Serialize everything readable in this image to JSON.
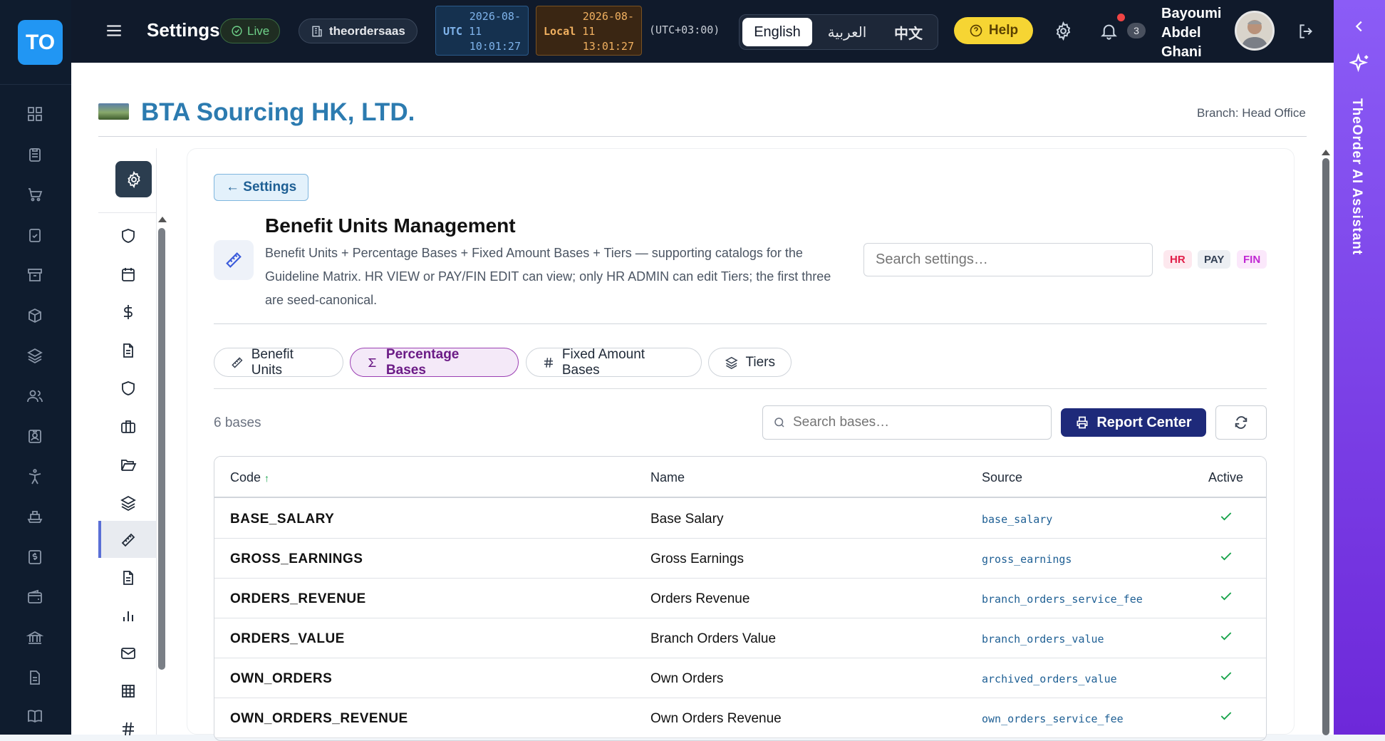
{
  "app": {
    "logo_text": "TO",
    "title": "Settings",
    "live_label": "Live",
    "tenant": "theordersaas"
  },
  "clocks": {
    "utc_label": "UTC",
    "utc_date1": "2026-08-",
    "utc_date2": "11",
    "utc_time": "10:01:27",
    "local_label": "Local",
    "local_date1": "2026-08-",
    "local_date2": "11",
    "local_time": "13:01:27",
    "tz": "(UTC+03:00)"
  },
  "languages": [
    {
      "label": "English",
      "active": true
    },
    {
      "label": "العربية",
      "active": false
    },
    {
      "label": "中文",
      "active": false
    }
  ],
  "help_label": "Help",
  "notifications_count": "3",
  "user": {
    "line1": "Bayoumi",
    "line2": "Abdel",
    "line3": "Ghani"
  },
  "ai_assistant": {
    "label": "TheOrder AI Assistant"
  },
  "company": {
    "name": "BTA Sourcing HK, LTD.",
    "branch": "Branch: Head Office"
  },
  "page": {
    "back_label": "← Settings",
    "title": "Benefit Units Management",
    "description": "Benefit Units + Percentage Bases + Fixed Amount Bases + Tiers — supporting catalogs for the Guideline Matrix. HR VIEW or PAY/FIN EDIT can view; only HR ADMIN can edit Tiers; the first three are seed-canonical.",
    "search_placeholder": "Search settings…",
    "tags": [
      {
        "label": "HR",
        "color": "#e11d48",
        "bg": "#fde8ee"
      },
      {
        "label": "PAY",
        "color": "#334155",
        "bg": "#eceff3"
      },
      {
        "label": "FIN",
        "color": "#c026d3",
        "bg": "#fbe8fb"
      }
    ]
  },
  "tabs": [
    {
      "label": "Benefit Units",
      "icon": "ruler-icon",
      "active": false
    },
    {
      "label": "Percentage Bases",
      "icon": "sigma-icon",
      "active": true
    },
    {
      "label": "Fixed Amount Bases",
      "icon": "hash-icon",
      "active": false
    },
    {
      "label": "Tiers",
      "icon": "layers-icon",
      "active": false
    }
  ],
  "list": {
    "count_label": "6 bases",
    "search_placeholder": "Search bases…",
    "report_label": "Report Center",
    "columns": {
      "code": "Code",
      "code_sort": "↑",
      "name": "Name",
      "source": "Source",
      "active": "Active"
    },
    "rows": [
      {
        "code": "BASE_SALARY",
        "name": "Base Salary",
        "source": "base_salary",
        "active": true
      },
      {
        "code": "GROSS_EARNINGS",
        "name": "Gross Earnings",
        "source": "gross_earnings",
        "active": true
      },
      {
        "code": "ORDERS_REVENUE",
        "name": "Orders Revenue",
        "source": "branch_orders_service_fee",
        "active": true
      },
      {
        "code": "ORDERS_VALUE",
        "name": "Branch Orders Value",
        "source": "branch_orders_value",
        "active": true
      },
      {
        "code": "OWN_ORDERS",
        "name": "Own Orders",
        "source": "archived_orders_value",
        "active": true
      },
      {
        "code": "OWN_ORDERS_REVENUE",
        "name": "Own Orders Revenue",
        "source": "own_orders_service_fee",
        "active": true
      }
    ]
  },
  "colors": {
    "accent": "#2196f3",
    "company": "#2c7bb0",
    "active_check": "#16a34a",
    "report_button": "#1e2a7a",
    "ai_bar": "#7c3aed"
  }
}
